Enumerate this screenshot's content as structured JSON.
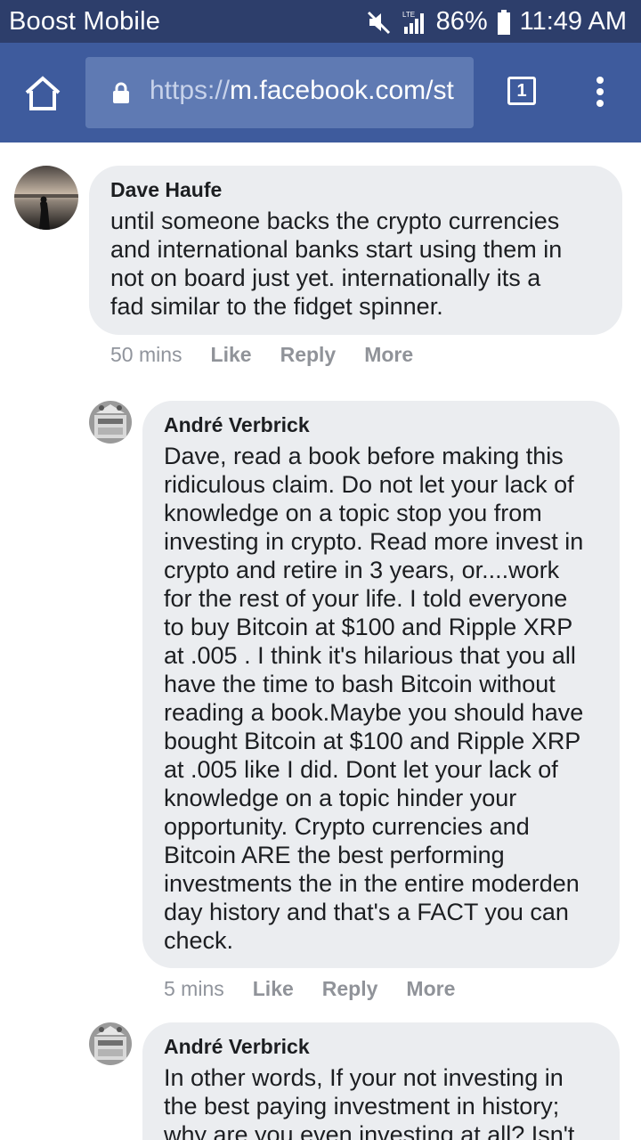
{
  "status_bar": {
    "carrier": "Boost Mobile",
    "network_badge": "LTE",
    "battery": "86%",
    "time": "11:49 AM",
    "icons": [
      "mute-icon",
      "signal-icon",
      "battery-icon"
    ]
  },
  "browser": {
    "url_scheme": "https://",
    "url_host": "m.facebook.com/st",
    "tab_count": "1",
    "icons": [
      "home-icon",
      "lock-icon",
      "tabs-icon",
      "overflow-menu-icon"
    ]
  },
  "comments": [
    {
      "author": "Dave Haufe",
      "lines": [
        "until someone backs the crypto currencies",
        "and international banks start using them in",
        "not on board just yet. internationally its a",
        "fad similar to the fidget spinner."
      ],
      "time": "50 mins",
      "actions": [
        "Like",
        "Reply",
        "More"
      ]
    },
    {
      "author": "André Verbrick",
      "lines": [
        "Dave, read a book before making this",
        "ridiculous claim. Do not let your lack of",
        "knowledge on a topic stop you from",
        "investing in crypto. Read more invest in",
        "crypto and retire in 3 years, or....work",
        "for the rest of your life. I told everyone",
        "to buy Bitcoin at $100 and Ripple XRP",
        "at .005 . I think it's hilarious that you all",
        "have the time to bash Bitcoin without",
        "reading a book.Maybe you should have",
        "bought Bitcoin at $100 and Ripple XRP",
        "at .005 like I did. Dont let your lack of",
        "knowledge on a topic hinder your",
        "opportunity. Crypto currencies and",
        "Bitcoin ARE the best performing",
        "investments the in the entire moderden",
        "day history and that's a FACT you can",
        "check."
      ],
      "time": "5 mins",
      "actions": [
        "Like",
        "Reply",
        "More"
      ]
    },
    {
      "author": "André Verbrick",
      "lines": [
        "In other words, If your not investing in",
        "the best paying investment in history;",
        "why are you even investing at all? Isn't"
      ]
    }
  ]
}
